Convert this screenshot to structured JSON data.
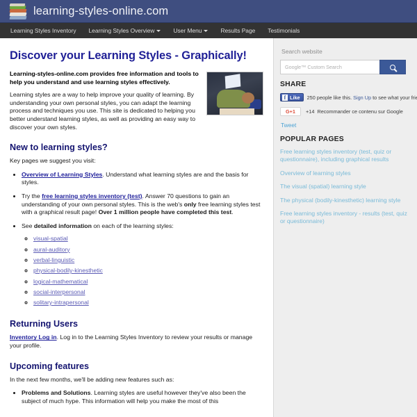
{
  "header": {
    "site_title": "learning-styles-online.com",
    "logo_icon": "stacked-books-icon"
  },
  "nav": {
    "items": [
      {
        "label": "Learning Styles Inventory",
        "has_dropdown": false
      },
      {
        "label": "Learning Styles Overview",
        "has_dropdown": true
      },
      {
        "label": "User Menu",
        "has_dropdown": true
      },
      {
        "label": "Results Page",
        "has_dropdown": false
      },
      {
        "label": "Testimonials",
        "has_dropdown": false
      }
    ]
  },
  "main": {
    "page_title": "Discover your Learning Styles - Graphically!",
    "lead_paragraph": "Learning-styles-online.com provides free information and tools to help you understand and use learning styles effectively.",
    "intro_paragraph": "Learning styles are a way to help improve your quality of learning. By understanding your own personal styles, you can adapt the learning process and techniques you use. This site is dedicated to helping you better understand learning styles, as well as providing an easy way to discover your own styles.",
    "intro_photo_alt": "child-reading-photo",
    "new_section": {
      "heading": "New to learning styles?",
      "intro": "Key pages we suggest you visit:",
      "bullets": [
        {
          "link": "Overview of Learning Styles",
          "text_after": ". Understand what learning styles are and the basis for styles."
        },
        {
          "text_before": "Try the ",
          "link": "free learning styles inventory (test)",
          "text_after": ". Answer 70 questions to gain an understanding of your own personal styles. This is the web's ",
          "bold_1": "only",
          "text_mid": " free learning styles test with a graphical result page! ",
          "bold_2": "Over 1 million people have completed this test",
          "text_end": "."
        },
        {
          "text_before": "See ",
          "bold_1": "detailed information",
          "text_after": " on each of the learning styles:"
        }
      ],
      "style_links": [
        "visual-spatial",
        "aural-auditory",
        "verbal-linguistic",
        "physical-bodily-kinesthetic",
        "logical-mathematical",
        "social-interpersonal",
        "solitary-intrapersonal"
      ]
    },
    "returning_section": {
      "heading": "Returning Users",
      "link": "Inventory Log in",
      "text_after": ". Log in to the Learning Styles Inventory to review your results or manage your profile."
    },
    "upcoming_section": {
      "heading": "Upcoming features",
      "intro": "In the next few months, we'll be adding new features such as:",
      "bullet": {
        "bold": "Problems and Solutions",
        "text": ". Learning styles are useful however they've also been the subject of much hype. This information will help you make the most of this"
      }
    }
  },
  "sidebar": {
    "search_label": "Search website",
    "search_placeholder": "Google™ Custom Search",
    "search_value": "",
    "search_icon": "magnifier-icon",
    "share_heading": "SHARE",
    "facebook": {
      "button_label": "Like",
      "icon": "facebook-f-icon",
      "caption_count": "250 people like this.",
      "signup_link": "Sign Up",
      "caption_rest": "to see what your friends lik"
    },
    "googleplus": {
      "button_label": "G+1",
      "count": "+14",
      "caption": "Recommander ce contenu sur Google"
    },
    "twitter": {
      "label": "Tweet"
    },
    "popular_heading": "POPULAR PAGES",
    "popular_pages": [
      "Free learning styles inventory (test, quiz or questionnaire), including graphical results",
      "Overview of learning styles",
      "The visual (spatial) learning style",
      "The physical (bodily-kinesthetic) learning style",
      "Free learning styles inventory - results (test, quiz or questionnaire)"
    ]
  },
  "colors": {
    "header_blue": "#3f4e80",
    "nav_dark": "#333333",
    "title_navy": "#1f1f96",
    "link_navy": "#21219b",
    "sidebar_bg": "#eeeeee",
    "sidebar_link": "#79bad8",
    "facebook_blue": "#3b5998",
    "google_red": "#dd4b39",
    "twitter_blue": "#4da3d4"
  }
}
